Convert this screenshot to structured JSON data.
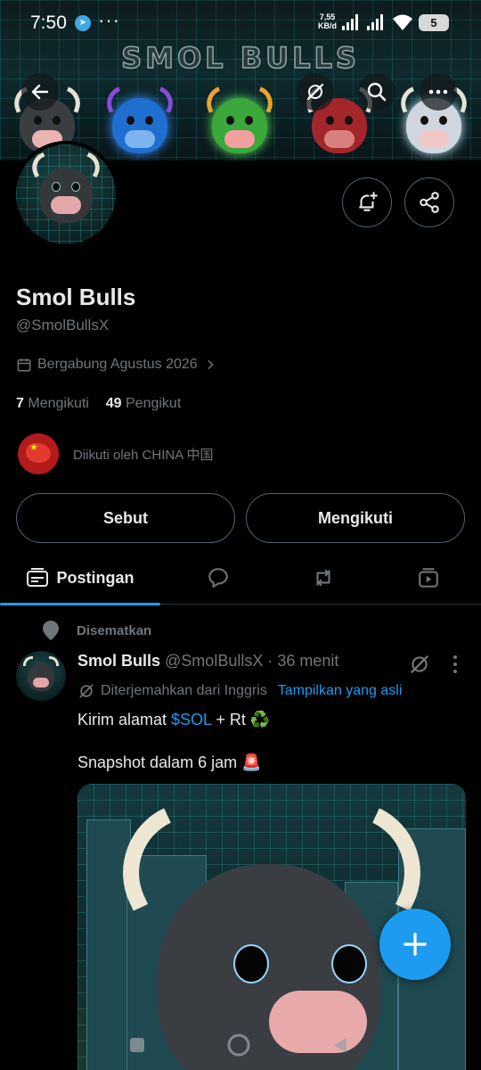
{
  "status_bar": {
    "time": "7:50",
    "net_speed_value": "7,55",
    "net_speed_unit": "KB/d",
    "battery": "5"
  },
  "banner": {
    "title": "SMOL BULLS",
    "bull_colors": [
      "#3a3e42",
      "#1f6fd1",
      "#3aa83a",
      "#a3262a",
      "#cfd6e0"
    ]
  },
  "profile": {
    "name": "Smol Bulls",
    "handle": "@SmolBullsX",
    "joined": "Bergabung Agustus 2026",
    "following_count": "7",
    "following_label": "Mengikuti",
    "followers_count": "49",
    "followers_label": "Pengikut",
    "followed_by": "Diikuti oleh CHINA 中国"
  },
  "actions": {
    "mention": "Sebut",
    "following": "Mengikuti"
  },
  "tabs": {
    "posts": "Postingan",
    "active_index": 0
  },
  "tweet": {
    "pinned_label": "Disematkan",
    "author_name": "Smol Bulls",
    "meta": "@SmolBullsX · 36 menit",
    "translated_from": "Diterjemahkan dari Inggris",
    "show_original": "Tampilkan yang asli",
    "line1_prefix": "Kirim alamat ",
    "line1_cashtag": "$SOL",
    "line1_suffix": " + Rt ♻️",
    "line2": "Snapshot dalam 6 jam 🚨"
  },
  "colors": {
    "accent": "#1d9bf0",
    "muted": "#71767b",
    "border": "#536471",
    "text": "#e7e9ea"
  },
  "icons": {
    "back": "arrow-left-icon",
    "grok": "grok-icon",
    "search": "search-icon",
    "more": "more-horizontal-icon",
    "notify": "bell-plus-icon",
    "share": "share-icon",
    "fab": "plus-icon"
  }
}
